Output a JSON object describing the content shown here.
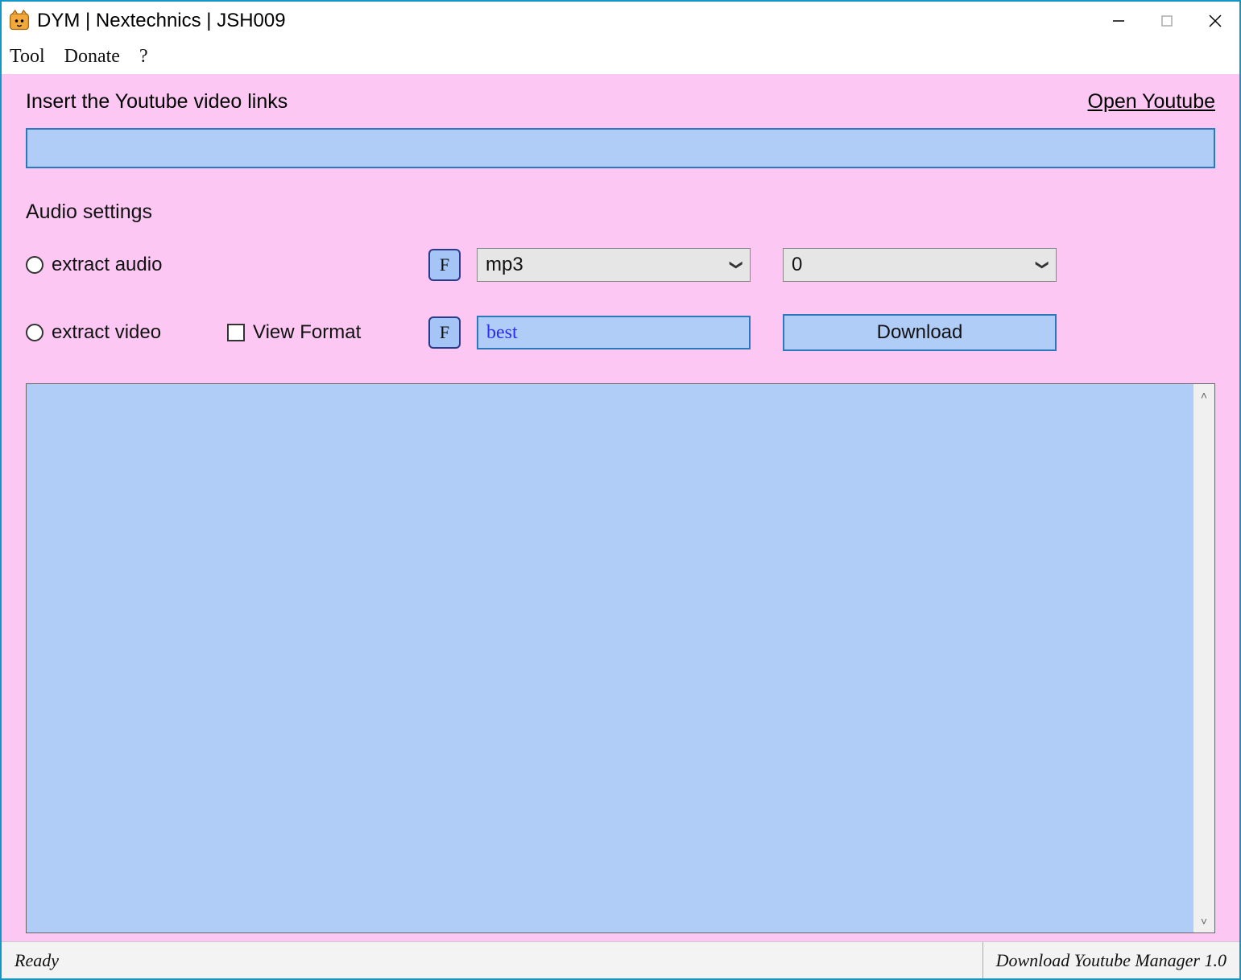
{
  "window": {
    "title": "DYM | Nextechnics | JSH009"
  },
  "menu": {
    "items": [
      "Tool",
      "Donate",
      "?"
    ]
  },
  "main": {
    "insert_label": "Insert the Youtube video links",
    "open_youtube": "Open Youtube",
    "url_value": "",
    "audio_settings_label": "Audio settings",
    "extract_audio_label": "extract audio",
    "extract_video_label": "extract video",
    "view_format_label": "View Format",
    "f_button_label": "F",
    "format_audio_selected": "mp3",
    "quality_selected": "0",
    "format_video_value": "best",
    "download_label": "Download"
  },
  "status": {
    "left": "Ready",
    "right": "Download Youtube Manager 1.0"
  }
}
